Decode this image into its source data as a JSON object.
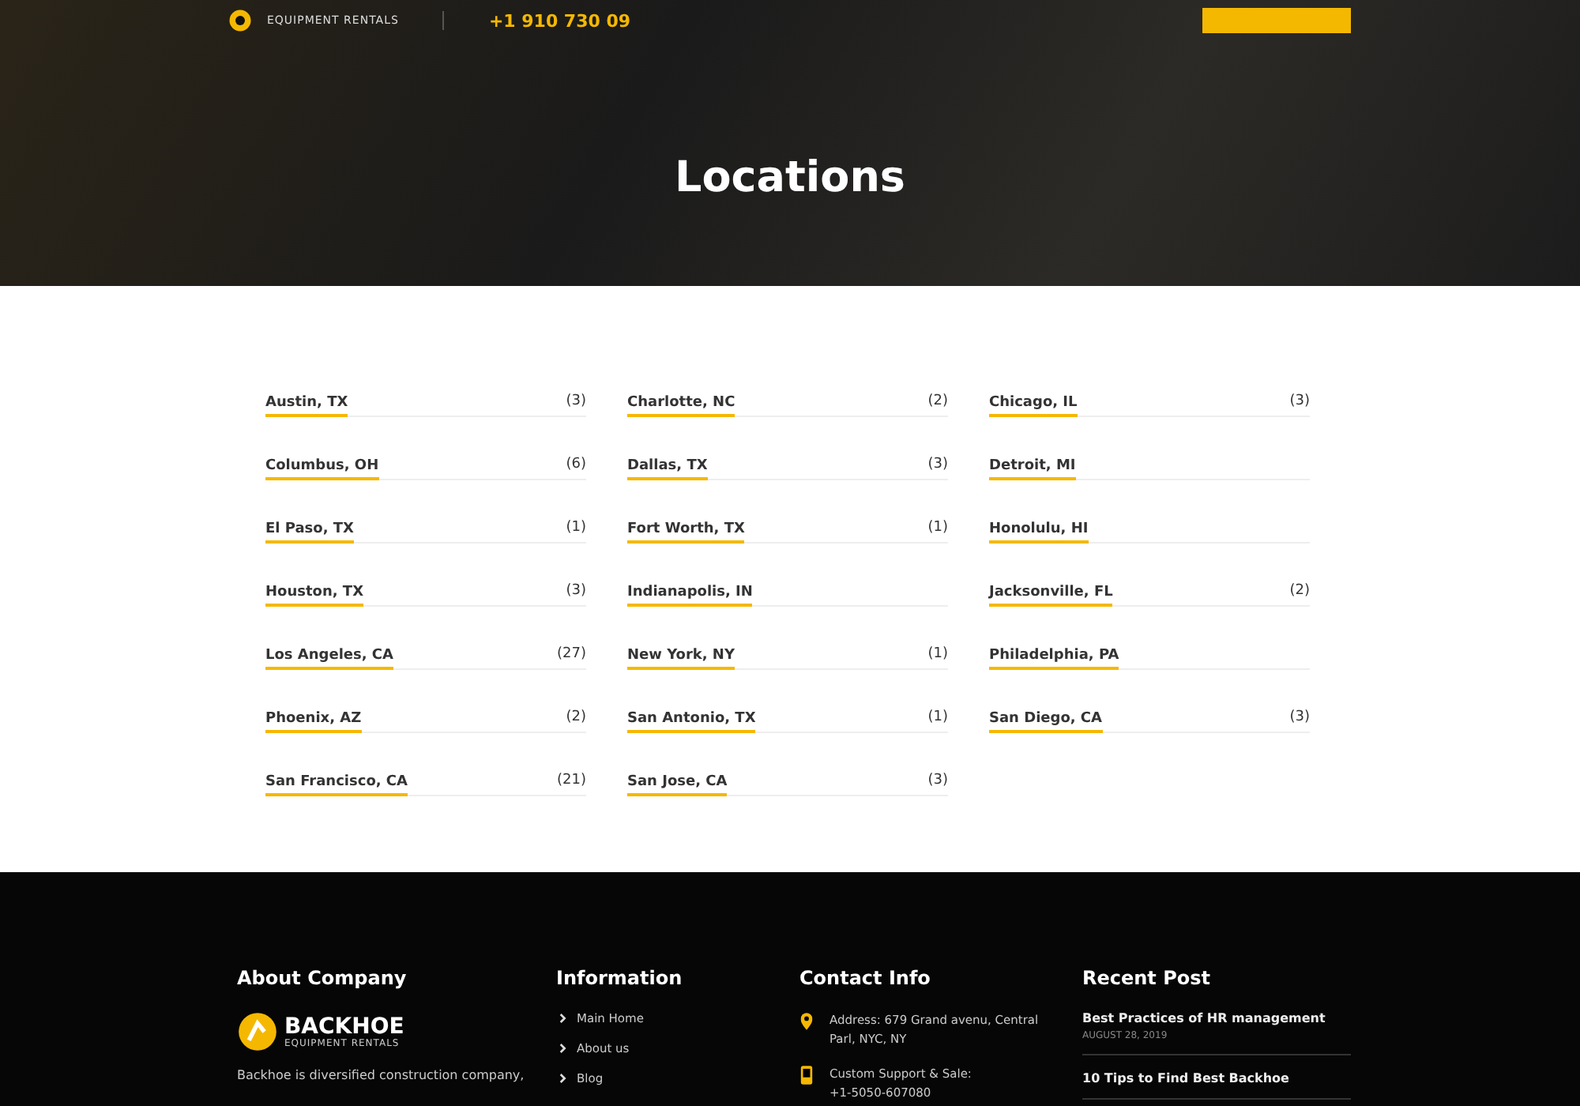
{
  "header": {
    "logo_tagline": "EQUIPMENT RENTALS",
    "phone": "+1 910 730 09"
  },
  "hero": {
    "title": "Locations"
  },
  "locations": [
    {
      "name": "Austin, TX",
      "count": "(3)"
    },
    {
      "name": "Charlotte, NC",
      "count": "(2)"
    },
    {
      "name": "Chicago, IL",
      "count": "(3)"
    },
    {
      "name": "Columbus, OH",
      "count": "(6)"
    },
    {
      "name": "Dallas, TX",
      "count": "(3)"
    },
    {
      "name": "Detroit, MI"
    },
    {
      "name": "El Paso, TX",
      "count": "(1)"
    },
    {
      "name": "Fort Worth, TX",
      "count": "(1)"
    },
    {
      "name": "Honolulu, HI"
    },
    {
      "name": "Houston, TX",
      "count": "(3)"
    },
    {
      "name": "Indianapolis, IN"
    },
    {
      "name": "Jacksonville, FL",
      "count": "(2)"
    },
    {
      "name": "Los Angeles, CA",
      "count": "(27)"
    },
    {
      "name": "New York, NY",
      "count": "(1)"
    },
    {
      "name": "Philadelphia, PA"
    },
    {
      "name": "Phoenix, AZ",
      "count": "(2)"
    },
    {
      "name": "San Antonio, TX",
      "count": "(1)"
    },
    {
      "name": "San Diego, CA",
      "count": "(3)"
    },
    {
      "name": "San Francisco, CA",
      "count": "(21)"
    },
    {
      "name": "San Jose, CA",
      "count": "(3)"
    }
  ],
  "footer": {
    "about": {
      "title": "About Company",
      "logo_name": "BACKHOE",
      "logo_tagline": "EQUIPMENT RENTALS",
      "text": "Backhoe is diversified construction company,"
    },
    "information": {
      "title": "Information",
      "links": [
        "Main Home",
        "About us",
        "Blog"
      ]
    },
    "contact": {
      "title": "Contact Info",
      "items": [
        {
          "kind": "address",
          "lines": [
            "Address: 679 Grand avenu, Central",
            "Parl, NYC, NY"
          ]
        },
        {
          "kind": "phone",
          "lines": [
            "Custom Support & Sale:",
            "+1-5050-607080"
          ]
        }
      ]
    },
    "recent": {
      "title": "Recent Post",
      "posts": [
        {
          "title": "Best Practices of HR management",
          "date": "AUGUST 28, 2019"
        },
        {
          "title": "10 Tips to Find Best Backhoe"
        }
      ]
    }
  }
}
